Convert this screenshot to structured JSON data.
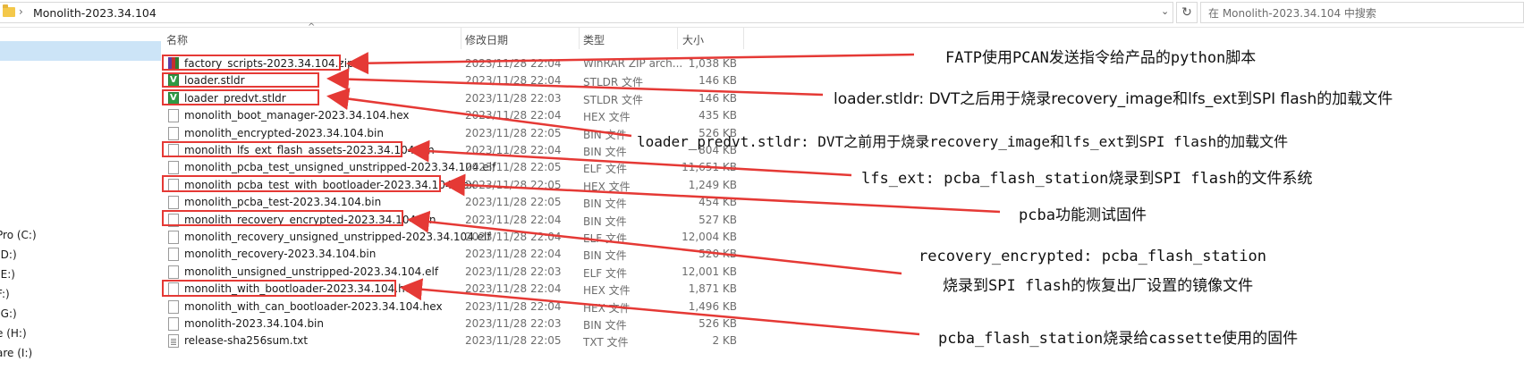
{
  "address_bar": {
    "path": "Monolith-2023.34.104",
    "search_placeholder": "在 Monolith-2023.34.104 中搜索"
  },
  "nav": {
    "drives": [
      "Pro (C:)",
      "(D:)",
      "(E:)",
      "F:)",
      "(G:)",
      "e (H:)",
      "are (I:)"
    ]
  },
  "columns": {
    "name": "名称",
    "date": "修改日期",
    "type": "类型",
    "size": "大小"
  },
  "files": [
    {
      "name": "factory_scripts-2023.34.104.zip",
      "date": "2023/11/28 22:04",
      "type": "WinRAR ZIP arch...",
      "size": "1,038 KB",
      "icon": "zip-icon"
    },
    {
      "name": "loader.stldr",
      "date": "2023/11/28 22:04",
      "type": "STLDR 文件",
      "size": "146 KB",
      "icon": "stldr-icon"
    },
    {
      "name": "loader_predvt.stldr",
      "date": "2023/11/28 22:03",
      "type": "STLDR 文件",
      "size": "146 KB",
      "icon": "stldr-icon"
    },
    {
      "name": "monolith_boot_manager-2023.34.104.hex",
      "date": "2023/11/28 22:04",
      "type": "HEX 文件",
      "size": "435 KB",
      "icon": "file-icon"
    },
    {
      "name": "monolith_encrypted-2023.34.104.bin",
      "date": "2023/11/28 22:05",
      "type": "BIN 文件",
      "size": "526 KB",
      "icon": "file-icon"
    },
    {
      "name": "monolith_lfs_ext_flash_assets-2023.34.104.bin",
      "date": "2023/11/28 22:04",
      "type": "BIN 文件",
      "size": "804 KB",
      "icon": "file-icon"
    },
    {
      "name": "monolith_pcba_test_unsigned_unstripped-2023.34.104.elf",
      "date": "2023/11/28 22:05",
      "type": "ELF 文件",
      "size": "11,651 KB",
      "icon": "file-icon"
    },
    {
      "name": "monolith_pcba_test_with_bootloader-2023.34.104.hex",
      "date": "2023/11/28 22:05",
      "type": "HEX 文件",
      "size": "1,249 KB",
      "icon": "file-icon"
    },
    {
      "name": "monolith_pcba_test-2023.34.104.bin",
      "date": "2023/11/28 22:05",
      "type": "BIN 文件",
      "size": "454 KB",
      "icon": "file-icon"
    },
    {
      "name": "monolith_recovery_encrypted-2023.34.104.bin",
      "date": "2023/11/28 22:04",
      "type": "BIN 文件",
      "size": "527 KB",
      "icon": "file-icon"
    },
    {
      "name": "monolith_recovery_unsigned_unstripped-2023.34.104.elf",
      "date": "2023/11/28 22:04",
      "type": "ELF 文件",
      "size": "12,004 KB",
      "icon": "file-icon"
    },
    {
      "name": "monolith_recovery-2023.34.104.bin",
      "date": "2023/11/28 22:04",
      "type": "BIN 文件",
      "size": "520 KB",
      "icon": "file-icon"
    },
    {
      "name": "monolith_unsigned_unstripped-2023.34.104.elf",
      "date": "2023/11/28 22:03",
      "type": "ELF 文件",
      "size": "12,001 KB",
      "icon": "file-icon"
    },
    {
      "name": "monolith_with_bootloader-2023.34.104.hex",
      "date": "2023/11/28 22:04",
      "type": "HEX 文件",
      "size": "1,871 KB",
      "icon": "file-icon"
    },
    {
      "name": "monolith_with_can_bootloader-2023.34.104.hex",
      "date": "2023/11/28 22:04",
      "type": "HEX 文件",
      "size": "1,496 KB",
      "icon": "file-icon"
    },
    {
      "name": "monolith-2023.34.104.bin",
      "date": "2023/11/28 22:03",
      "type": "BIN 文件",
      "size": "526 KB",
      "icon": "file-icon"
    },
    {
      "name": "release-sha256sum.txt",
      "date": "2023/11/28 22:05",
      "type": "TXT 文件",
      "size": "2 KB",
      "icon": "txt-icon"
    }
  ],
  "annotations": [
    "FATP使用PCAN发送指令给产品的python脚本",
    "loader.stldr: DVT之后用于烧录recovery_image和lfs_ext到SPI flash的加载文件",
    "loader_predvt.stldr: DVT之前用于烧录recovery_image和lfs_ext到SPI flash的加载文件",
    "lfs_ext: pcba_flash_station烧录到SPI flash的文件系统",
    "pcba功能测试固件",
    "recovery_encrypted: pcba_flash_station",
    "烧录到SPI flash的恢复出厂设置的镜像文件",
    "pcba_flash_station烧录给cassette使用的固件"
  ],
  "colors": {
    "annotation_red": "#e53935",
    "selection_blue": "#cce4f7",
    "folder_yellow": "#f4c84a"
  }
}
